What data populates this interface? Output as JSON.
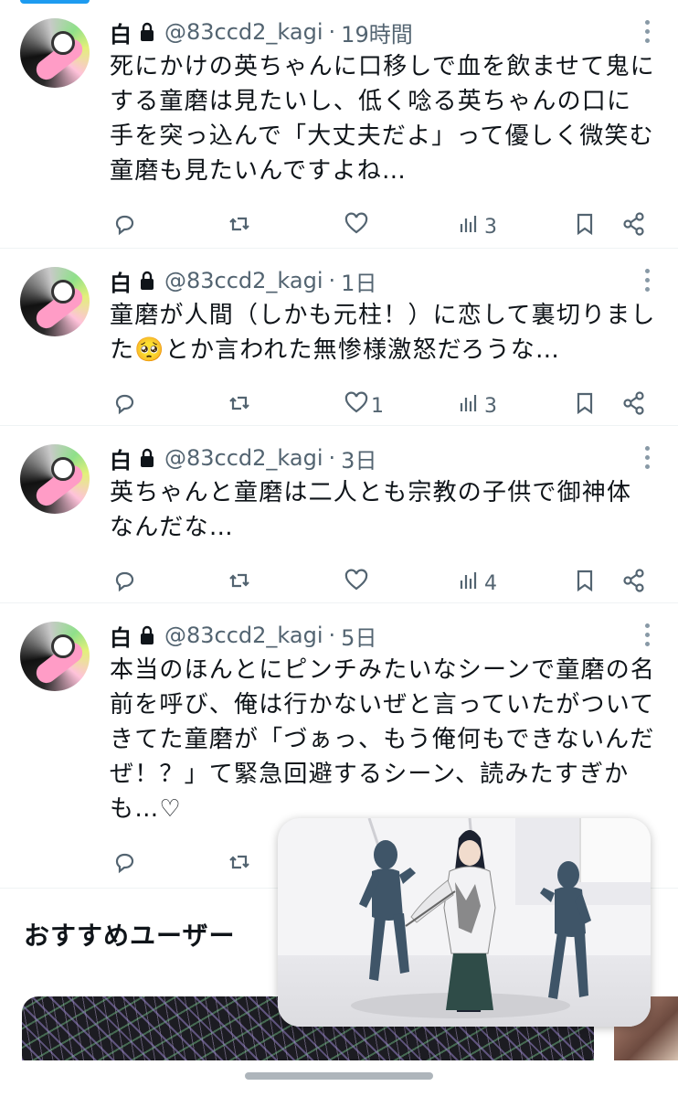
{
  "tweets": [
    {
      "name": "白",
      "handle": "@83ccd2_kagi",
      "separator": "·",
      "time": "19時間",
      "text": "死にかけの英ちゃんに口移しで血を飲ませて鬼にする童磨は見たいし、低く唸る英ちゃんの口に手を突っ込んで「大丈夫だよ」って優しく微笑む童磨も見たいんですよね…",
      "likes": "",
      "views": "3"
    },
    {
      "name": "白",
      "handle": "@83ccd2_kagi",
      "separator": "·",
      "time": "1日",
      "text": "童磨が人間（しかも元柱！）に恋して裏切りました🥺とか言われた無惨様激怒だろうな…",
      "likes": "1",
      "views": "3"
    },
    {
      "name": "白",
      "handle": "@83ccd2_kagi",
      "separator": "·",
      "time": "3日",
      "text": "英ちゃんと童磨は二人とも宗教の子供で御神体なんだな…",
      "likes": "",
      "views": "4"
    },
    {
      "name": "白",
      "handle": "@83ccd2_kagi",
      "separator": "·",
      "time": "5日",
      "text": "本当のほんとにピンチみたいなシーンで童磨の名前を呼び、俺は行かないぜと言っていたがついてきてた童磨が「づぁっ、もう俺何もできないんだぜ！？」て緊急回避するシーン、読みたすぎかも…♡",
      "likes": "",
      "views": ""
    }
  ],
  "recommendations": {
    "title": "おすすめユーザー"
  },
  "icons": {
    "reply": "reply-icon",
    "retweet": "retweet-icon",
    "like": "heart-icon",
    "views": "views-chart-icon",
    "bookmark": "bookmark-icon",
    "share": "share-icon",
    "more": "more-vertical-icon",
    "lock": "lock-icon"
  },
  "colors": {
    "accent": "#1d9bf0",
    "muted": "#536471",
    "text": "#0f1419"
  }
}
